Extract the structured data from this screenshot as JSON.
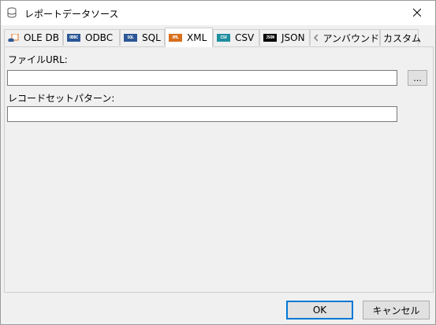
{
  "window": {
    "title": "レポートデータソース"
  },
  "tabs": [
    {
      "label": "OLE DB",
      "icon_text": ""
    },
    {
      "label": "ODBC",
      "icon_text": "ODBC"
    },
    {
      "label": "SQL",
      "icon_text": "SQL"
    },
    {
      "label": "XML",
      "icon_text": "XML"
    },
    {
      "label": "CSV",
      "icon_text": "CSV"
    },
    {
      "label": "JSON",
      "icon_text": "JSON"
    },
    {
      "label": "アンバウンド",
      "icon_text": ""
    },
    {
      "label": "カスタム",
      "icon_text": ""
    }
  ],
  "active_tab": "XML",
  "form": {
    "file_url_label": "ファイルURL:",
    "file_url_value": "",
    "browse_label": "...",
    "record_pattern_label": "レコードセットパターン:",
    "record_pattern_value": ""
  },
  "buttons": {
    "ok": "OK",
    "cancel": "キャンセル"
  },
  "colors": {
    "accent": "#0078d7",
    "odbc": "#2b5797",
    "sql": "#2b5797",
    "xml": "#d86f1d",
    "csv": "#1f8fa0",
    "json": "#000000"
  }
}
